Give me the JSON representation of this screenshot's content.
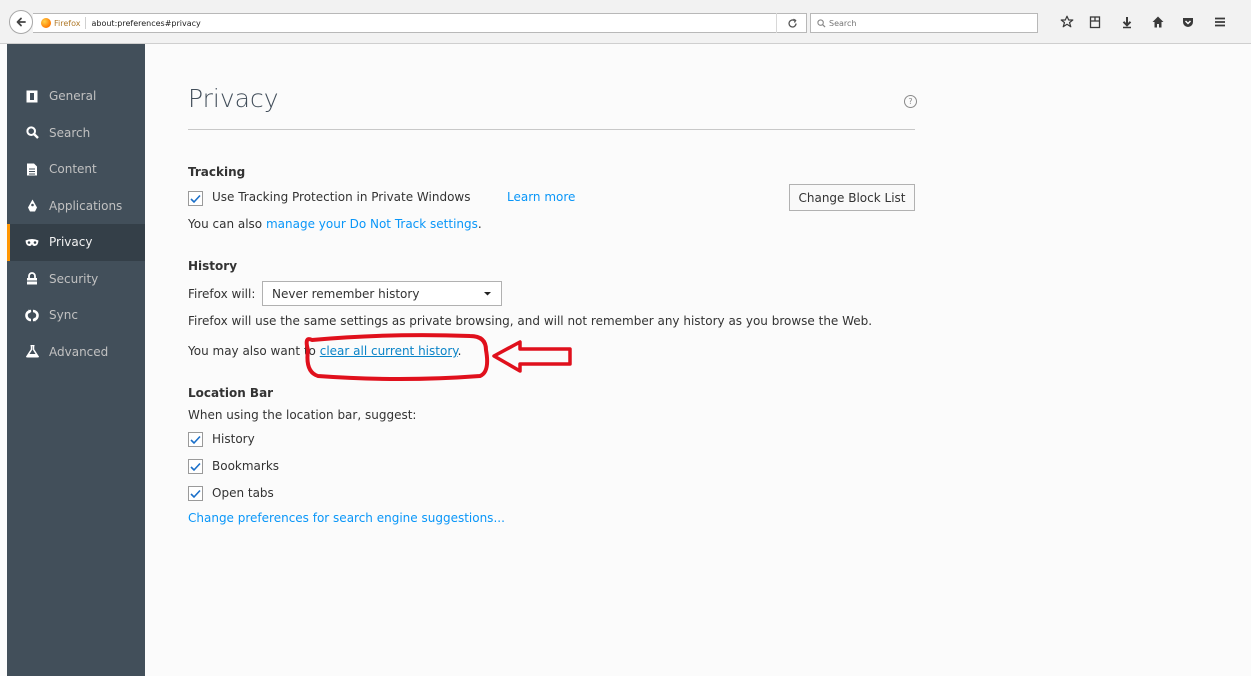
{
  "browser": {
    "identity_label": "Firefox",
    "url": "about:preferences#privacy",
    "search_placeholder": "Search"
  },
  "sidebar": {
    "items": [
      {
        "label": "General",
        "icon": "general-icon"
      },
      {
        "label": "Search",
        "icon": "search-icon"
      },
      {
        "label": "Content",
        "icon": "content-icon"
      },
      {
        "label": "Applications",
        "icon": "applications-icon"
      },
      {
        "label": "Privacy",
        "icon": "privacy-mask-icon",
        "selected": true
      },
      {
        "label": "Security",
        "icon": "lock-icon"
      },
      {
        "label": "Sync",
        "icon": "sync-icon"
      },
      {
        "label": "Advanced",
        "icon": "advanced-icon"
      }
    ]
  },
  "page": {
    "title": "Privacy",
    "help_symbol": "?"
  },
  "tracking": {
    "heading": "Tracking",
    "tracking_protection_label": "Use Tracking Protection in Private Windows",
    "tracking_protection_checked": true,
    "learn_more": "Learn more",
    "change_block_list": "Change Block List",
    "dnt_prefix": "You can also ",
    "dnt_link": "manage your Do Not Track settings",
    "dnt_suffix": "."
  },
  "history": {
    "heading": "History",
    "firefox_will_label": "Firefox will:",
    "mode_selected": "Never remember history",
    "description": "Firefox will use the same settings as private browsing, and will not remember any history as you browse the Web.",
    "clear_prefix": "You may also want to ",
    "clear_link": "clear all current history",
    "clear_suffix": "."
  },
  "location_bar": {
    "heading": "Location Bar",
    "suggest_label": "When using the location bar, suggest:",
    "options": [
      {
        "label": "History",
        "checked": true
      },
      {
        "label": "Bookmarks",
        "checked": true
      },
      {
        "label": "Open tabs",
        "checked": true
      }
    ],
    "search_suggestions_link": "Change preferences for search engine suggestions..."
  },
  "colors": {
    "sidebar_bg": "#424f5a",
    "sidebar_selected_bg": "#343f48",
    "selected_accent": "#ff9500",
    "link": "#0996f8",
    "annotation_red": "#e0101c"
  }
}
